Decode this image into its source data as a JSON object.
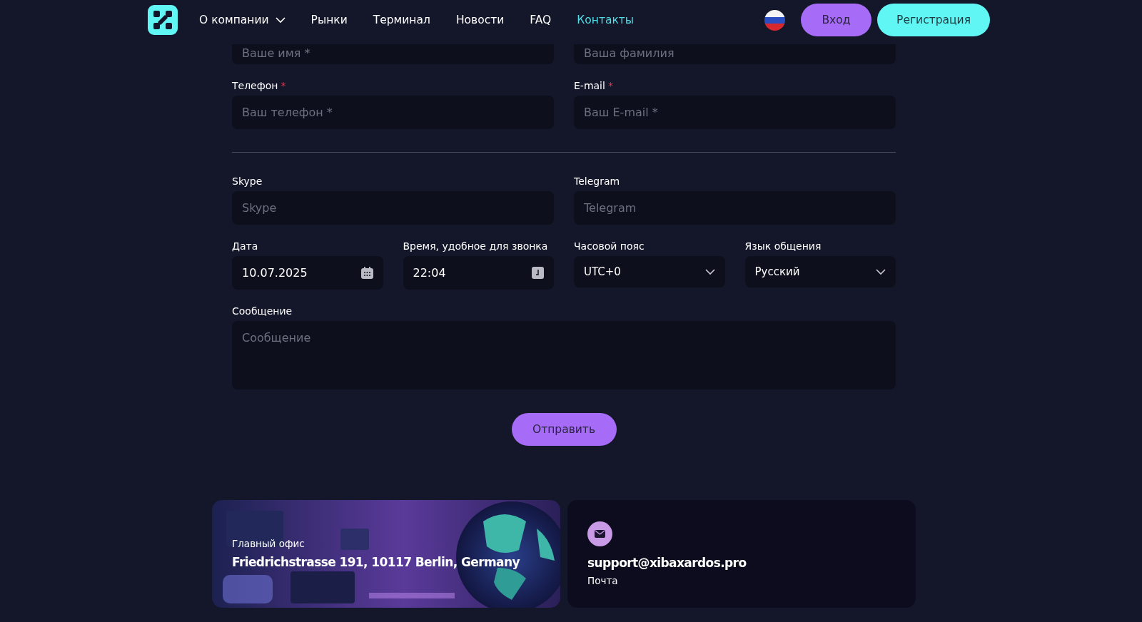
{
  "header": {
    "nav": [
      {
        "label": "О компании",
        "selected": false,
        "dropdown": true
      },
      {
        "label": "Рынки",
        "selected": false,
        "dropdown": false
      },
      {
        "label": "Терминал",
        "selected": false,
        "dropdown": false
      },
      {
        "label": "Новости",
        "selected": false,
        "dropdown": false
      },
      {
        "label": "FAQ",
        "selected": false,
        "dropdown": false
      },
      {
        "label": "Контакты",
        "selected": true,
        "dropdown": false
      }
    ],
    "login": "Вход",
    "register": "Регистрация"
  },
  "form": {
    "rows": [
      {
        "kind": "cut",
        "fields": [
          {
            "kind": "text",
            "placeholder": "Ваше имя *"
          },
          {
            "kind": "text",
            "placeholder": "Ваша фамилия"
          }
        ]
      },
      {
        "kind": "fields",
        "fields": [
          {
            "kind": "text",
            "label": "Телефон",
            "required_mark": "*",
            "placeholder": "Ваш телефон *"
          },
          {
            "kind": "text",
            "label": "E-mail",
            "required_mark": "*",
            "placeholder": "Ваш E-mail *"
          }
        ]
      },
      {
        "kind": "divider"
      },
      {
        "kind": "fields",
        "fields": [
          {
            "kind": "text",
            "label": "Skype",
            "placeholder": "Skype"
          },
          {
            "kind": "text",
            "label": "Telegram",
            "placeholder": "Telegram"
          }
        ]
      },
      {
        "kind": "fields",
        "fields": [
          {
            "kind": "date",
            "label": "Дата",
            "value": "10.07.2025"
          },
          {
            "kind": "time",
            "label": "Время, удобное для звонка",
            "value": "22:04"
          },
          {
            "kind": "select",
            "label": "Часовой пояс",
            "value": "UTC+0"
          },
          {
            "kind": "select",
            "label": "Язык общения",
            "value": "Русский"
          }
        ]
      },
      {
        "kind": "fields",
        "fields": [
          {
            "kind": "textarea",
            "label": "Сообщение",
            "placeholder": "Сообщение"
          }
        ]
      }
    ],
    "submit": "Отправить"
  },
  "cards": [
    {
      "kind": "office",
      "caption": "Главный офис",
      "title": "Friedrichstrasse 191, 10117 Berlin, Germany"
    },
    {
      "kind": "email",
      "title": "support@xibaxardos.pro",
      "caption": "Почта"
    }
  ]
}
